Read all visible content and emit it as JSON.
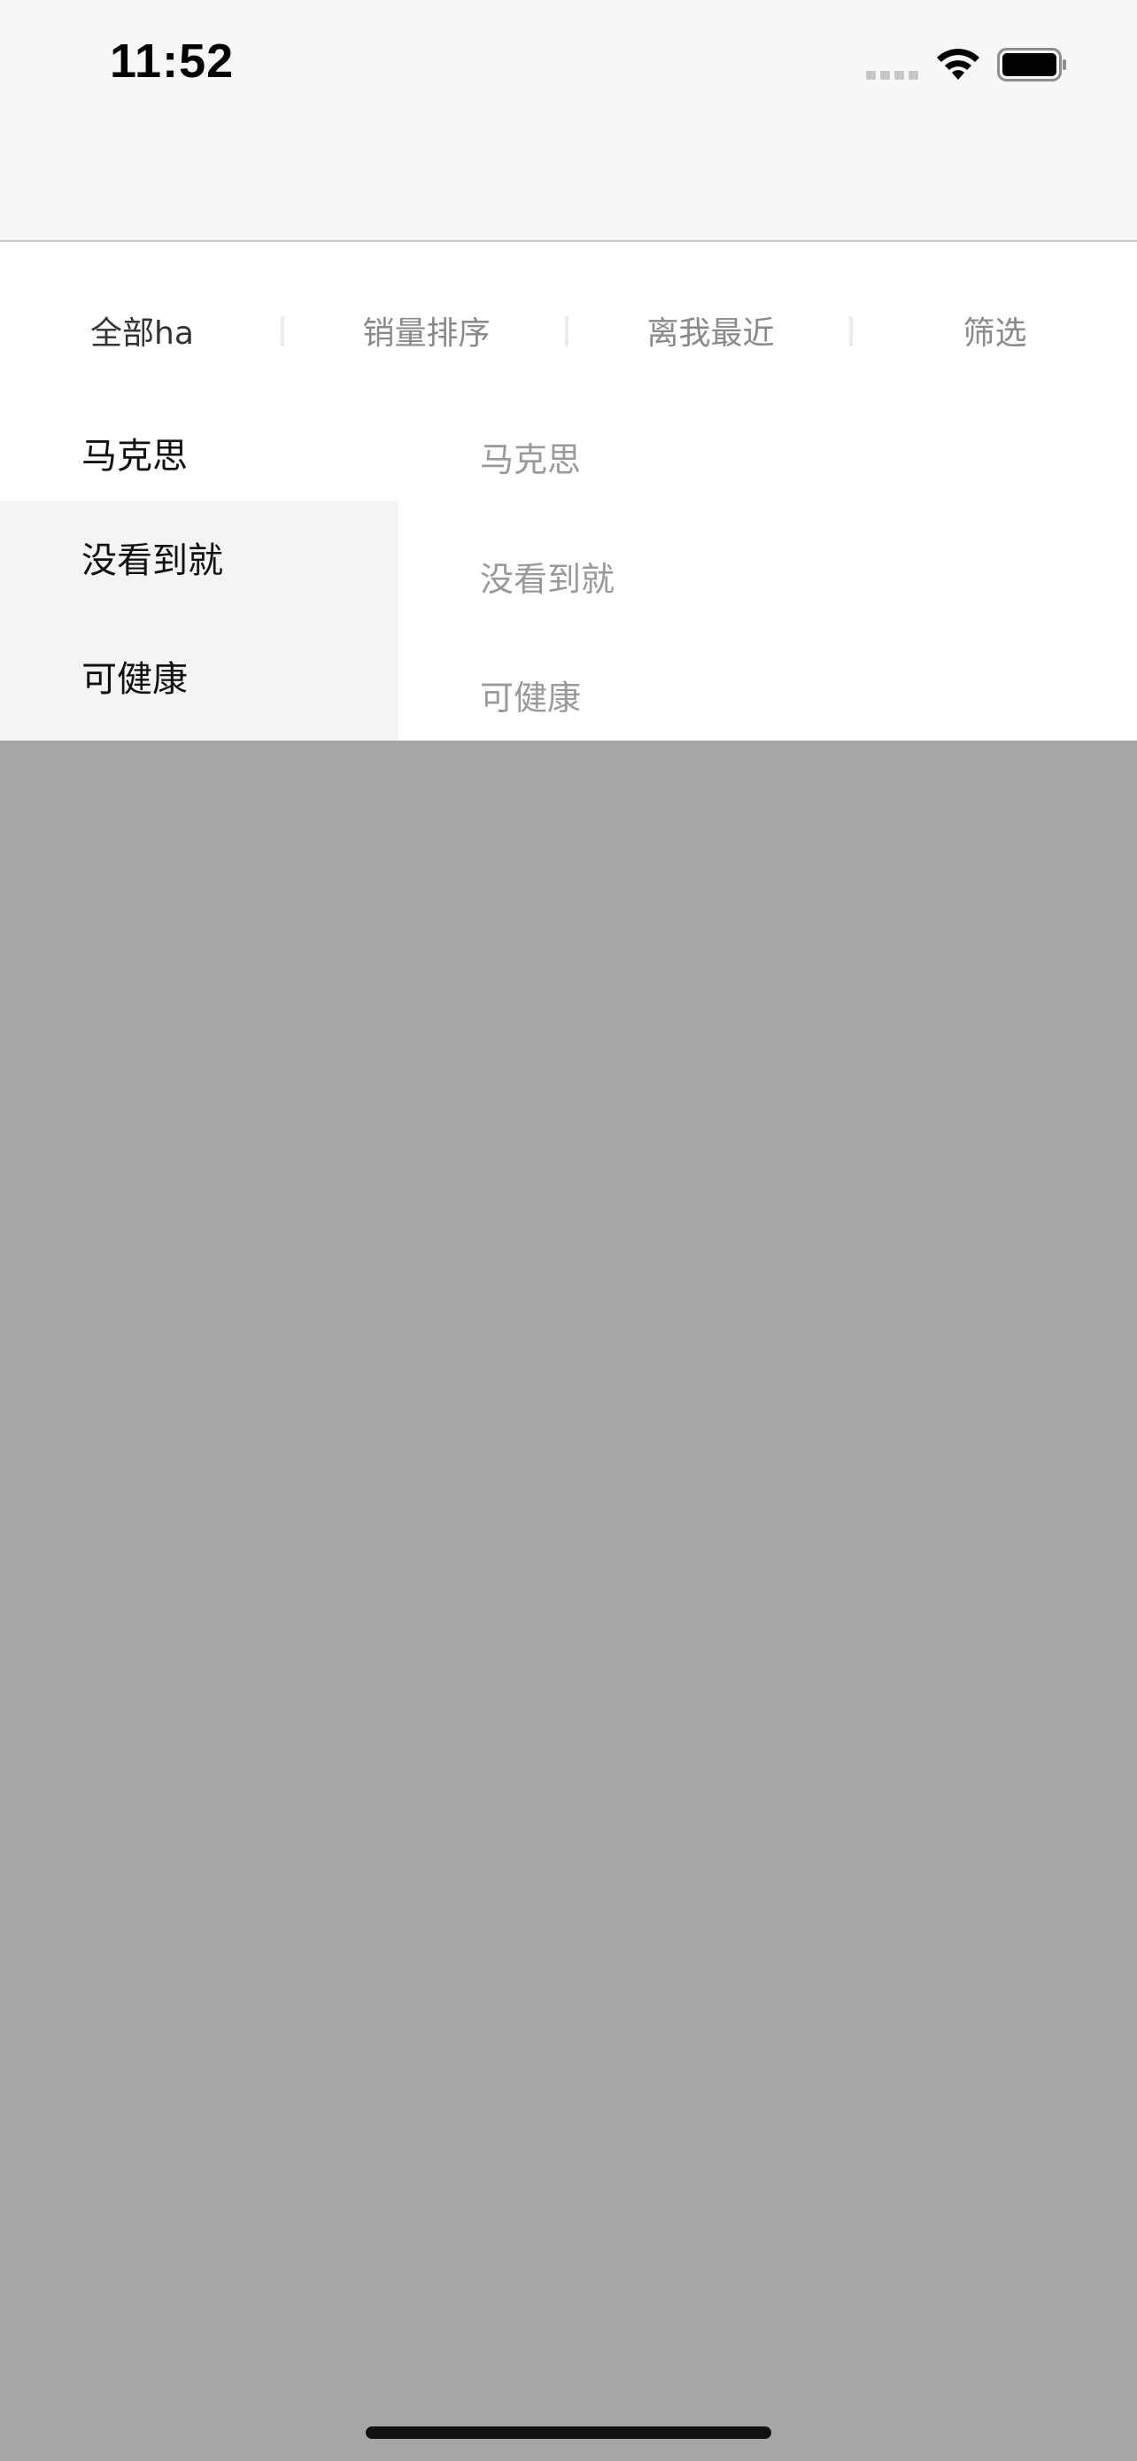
{
  "status_bar": {
    "time": "11:52",
    "signal_icon": "cellular-signal-icon",
    "wifi_icon": "wifi-icon",
    "battery_icon": "battery-icon"
  },
  "filter_tabs": [
    {
      "label": "全部ha",
      "active": true
    },
    {
      "label": "销量排序",
      "active": false
    },
    {
      "label": "离我最近",
      "active": false
    },
    {
      "label": "筛选",
      "active": false
    }
  ],
  "dropdown": {
    "left_items": [
      {
        "label": "马克思",
        "selected": true
      },
      {
        "label": "没看到就",
        "selected": false
      },
      {
        "label": "可健康",
        "selected": false
      }
    ],
    "right_items": [
      {
        "label": "马克思"
      },
      {
        "label": "没看到就"
      },
      {
        "label": "可健康"
      }
    ]
  },
  "colors": {
    "overlay": "#a6a6a6",
    "active_text": "#333333",
    "inactive_text": "#8a8a8a",
    "secondary_text": "#9a9a9a",
    "left_unselected_bg": "#f4f4f4"
  }
}
